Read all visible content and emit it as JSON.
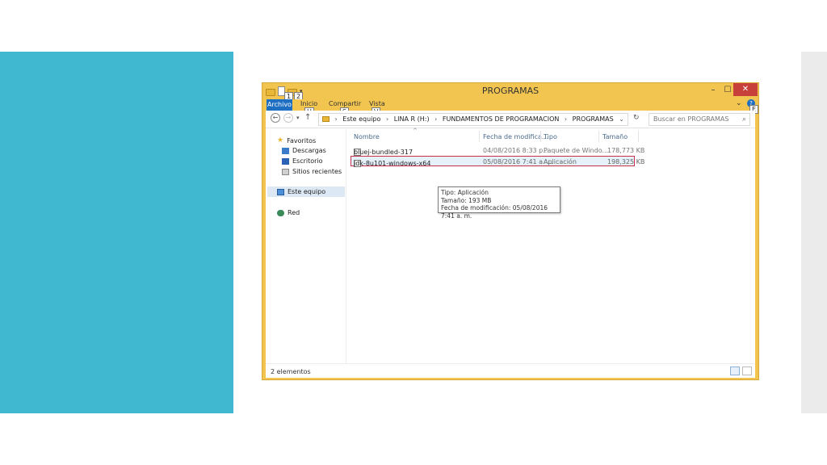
{
  "window": {
    "title": "PROGRAMAS",
    "minimize_glyph": "–",
    "maximize_glyph": "☐",
    "close_glyph": "✕",
    "keytips": [
      "1",
      "2",
      "H",
      "S",
      "V",
      "E"
    ]
  },
  "ribbon": {
    "tabs": {
      "file": "Archivo",
      "home": "Inicio",
      "share": "Compartir",
      "view": "Vista"
    },
    "collapse_glyph": "⌄",
    "help_glyph": "?"
  },
  "address": {
    "breadcrumbs": [
      "Este equipo",
      "LINA R (H:)",
      "FUNDAMENTOS DE PROGRAMACION",
      "PROGRAMAS"
    ],
    "search_placeholder": "Buscar en PROGRAMAS"
  },
  "nav_pane": {
    "favorites": "Favoritos",
    "downloads": "Descargas",
    "desktop": "Escritorio",
    "recent": "Sitios recientes",
    "this_pc": "Este equipo",
    "network": "Red"
  },
  "columns": {
    "name": "Nombre",
    "date": "Fecha de modifica...",
    "type": "Tipo",
    "size": "Tamaño"
  },
  "files": [
    {
      "name": "bluej-bundled-317",
      "date": "04/08/2016 8:33 p....",
      "type": "Paquete de Windo...",
      "size": "178,773 KB"
    },
    {
      "name": "jdk-8u101-windows-x64",
      "date": "05/08/2016 7:41 a. ...",
      "type": "Aplicación",
      "size": "198,325 KB"
    }
  ],
  "tooltip": {
    "type_line": "Tipo: Aplicación",
    "size_line": "Tamaño: 193 MB",
    "date_line": "Fecha de modificación: 05/08/2016 7:41 a. m."
  },
  "status": {
    "count": "2 elementos"
  },
  "colors": {
    "teal_panel": "#3fb8d0",
    "window_frame": "#f2c550",
    "file_tab": "#1e6fc2",
    "selection_border": "#c8304a"
  }
}
